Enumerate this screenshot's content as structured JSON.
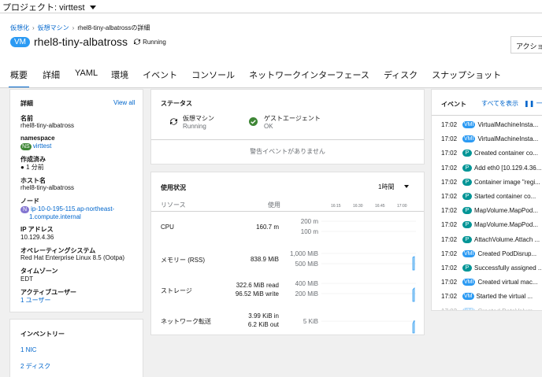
{
  "project": {
    "label": "プロジェクト: virttest"
  },
  "breadcrumb": {
    "item1": "仮想化",
    "item2": "仮想マシン",
    "item3": "rhel8-tiny-albatrossの詳細"
  },
  "vm": {
    "badge": "VM",
    "name": "rhel8-tiny-albatross",
    "status": "Running"
  },
  "actions_label": "アクション",
  "tabs": [
    {
      "label": "概要"
    },
    {
      "label": "詳細"
    },
    {
      "label": "YAML"
    },
    {
      "label": "環境"
    },
    {
      "label": "イベント"
    },
    {
      "label": "コンソール"
    },
    {
      "label": "ネットワークインターフェース"
    },
    {
      "label": "ディスク"
    },
    {
      "label": "スナップショット"
    }
  ],
  "details": {
    "title": "詳細",
    "view_all": "View all",
    "name_key": "名前",
    "name_val": "rhel8-tiny-albatross",
    "ns_key": "namespace",
    "ns_badge": "NS",
    "ns_val": "virttest",
    "created_key": "作成済み",
    "created_val": "1 分前",
    "host_key": "ホスト名",
    "host_val": "rhel8-tiny-albatross",
    "node_key": "ノード",
    "node_badge": "N",
    "node_line1": "ip-10-0-195-115.ap-northeast-",
    "node_line2": "1.compute.internal",
    "ip_key": "IP アドレス",
    "ip_val": "10.129.4.36",
    "os_key": "オペレーティングシステム",
    "os_val": "Red Hat Enterprise Linux 8.5 (Ootpa)",
    "tz_key": "タイムゾーン",
    "tz_val": "EDT",
    "users_key": "アクティブユーザー",
    "users_val": "1 ユーザー"
  },
  "inventory": {
    "title": "インベントリー",
    "nic": "1 NIC",
    "disk": "2 ディスク"
  },
  "status_card": {
    "title": "ステータス",
    "vm_label": "仮想マシン",
    "vm_state": "Running",
    "agent_label": "ゲストエージェント",
    "agent_state": "OK",
    "no_alerts": "警告イベントがありません"
  },
  "utilization": {
    "title": "使用状況",
    "range": "1時間",
    "col_resource": "リソース",
    "col_usage": "使用",
    "time_ticks": [
      "16:15",
      "16:30",
      "16:45",
      "17:00"
    ],
    "rows": [
      {
        "label": "CPU",
        "value": "160.7 m",
        "value2": "",
        "axis_top": "200 m",
        "axis_bottom": "100 m"
      },
      {
        "label": "メモリー (RSS)",
        "value": "838.9 MiB",
        "value2": "",
        "axis_top": "1,000 MiB",
        "axis_bottom": "500 MiB"
      },
      {
        "label": "ストレージ",
        "value": "322.6 MiB read",
        "value2": "96.52 MiB write",
        "axis_top": "400 MiB",
        "axis_bottom": "200 MiB"
      },
      {
        "label": "ネットワーク転送",
        "value": "3.99 KiB in",
        "value2": "6.2 KiB out",
        "axis_top": "",
        "axis_bottom": "5 KiB"
      }
    ]
  },
  "events": {
    "title": "イベント",
    "show_all": "すべてを表示",
    "pause": "一時",
    "items": [
      {
        "time": "17:02",
        "badge": "VMI",
        "kind": "vm",
        "text": "VirtualMachineInsta..."
      },
      {
        "time": "17:02",
        "badge": "VMI",
        "kind": "vm",
        "text": "VirtualMachineInsta..."
      },
      {
        "time": "17:02",
        "badge": "P",
        "kind": "p",
        "text": "Created container co..."
      },
      {
        "time": "17:02",
        "badge": "P",
        "kind": "p",
        "text": "Add eth0 [10.129.4.36..."
      },
      {
        "time": "17:02",
        "badge": "P",
        "kind": "p",
        "text": "Container image \"regi..."
      },
      {
        "time": "17:02",
        "badge": "P",
        "kind": "p",
        "text": "Started container co..."
      },
      {
        "time": "17:02",
        "badge": "P",
        "kind": "p",
        "text": "MapVolume.MapPod..."
      },
      {
        "time": "17:02",
        "badge": "P",
        "kind": "p",
        "text": "MapVolume.MapPod..."
      },
      {
        "time": "17:02",
        "badge": "P",
        "kind": "p",
        "text": "AttachVolume.Attach ..."
      },
      {
        "time": "17:02",
        "badge": "VMI",
        "kind": "vm",
        "text": "Created PodDisrup..."
      },
      {
        "time": "17:02",
        "badge": "P",
        "kind": "p",
        "text": "Successfully assigned ..."
      },
      {
        "time": "17:02",
        "badge": "VMI",
        "kind": "vm",
        "text": "Created virtual mac..."
      },
      {
        "time": "17:02",
        "badge": "VM",
        "kind": "vm",
        "text": "Started the virtual ..."
      },
      {
        "time": "17:02",
        "badge": "VMI",
        "kind": "vm",
        "text": "Created DataVolum..."
      }
    ]
  },
  "colors": {
    "accent": "#0066cc",
    "vm_badge": "#2b9af3",
    "pod_badge": "#009596",
    "ns_badge": "#3e8635",
    "ok_green": "#3e8635",
    "spark": "#2b9af3"
  }
}
